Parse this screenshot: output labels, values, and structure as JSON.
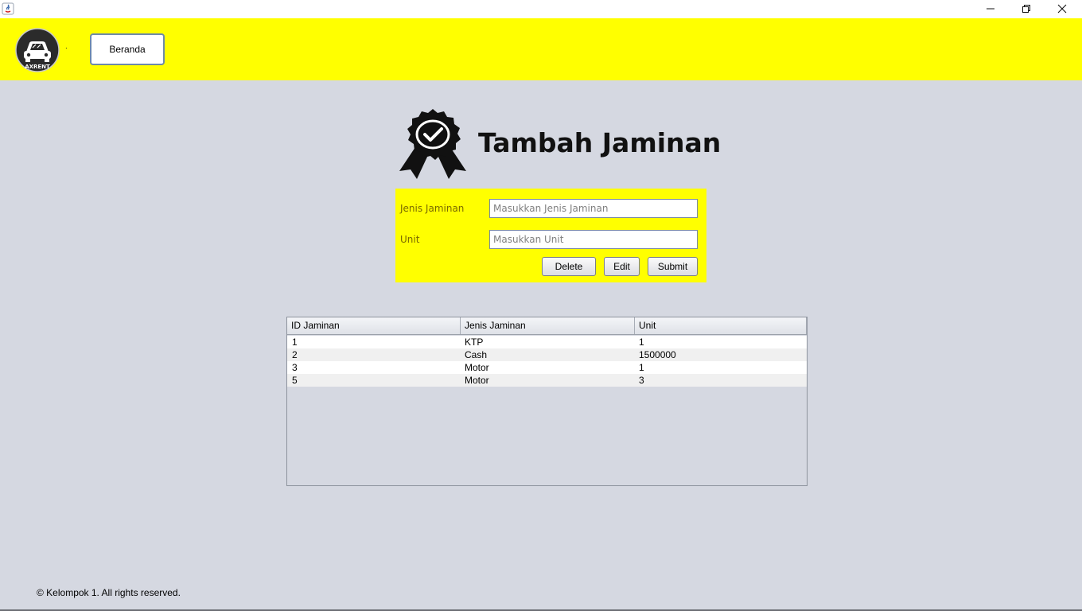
{
  "window": {
    "controls": [
      "minimize",
      "maximize",
      "close"
    ]
  },
  "header": {
    "background": "#ffff00",
    "logo_text": "AXRENT",
    "dot": ".",
    "nav_button": "Beranda"
  },
  "page": {
    "title": "Tambah Jaminan",
    "icon": "award-badge-icon"
  },
  "form": {
    "jenis_label": "Jenis Jaminan",
    "jenis_placeholder": "Masukkan Jenis Jaminan",
    "unit_label": "Unit",
    "unit_placeholder": "Masukkan Unit",
    "delete_label": "Delete",
    "edit_label": "Edit",
    "submit_label": "Submit"
  },
  "table": {
    "columns": [
      "ID Jaminan",
      "Jenis Jaminan",
      "Unit"
    ],
    "rows": [
      [
        "1",
        "KTP",
        "1"
      ],
      [
        "2",
        "Cash",
        "1500000"
      ],
      [
        "3",
        "Motor",
        "1"
      ],
      [
        "5",
        "Motor",
        "3"
      ]
    ]
  },
  "footer": {
    "text": "© Kelompok 1. All rights reserved."
  }
}
